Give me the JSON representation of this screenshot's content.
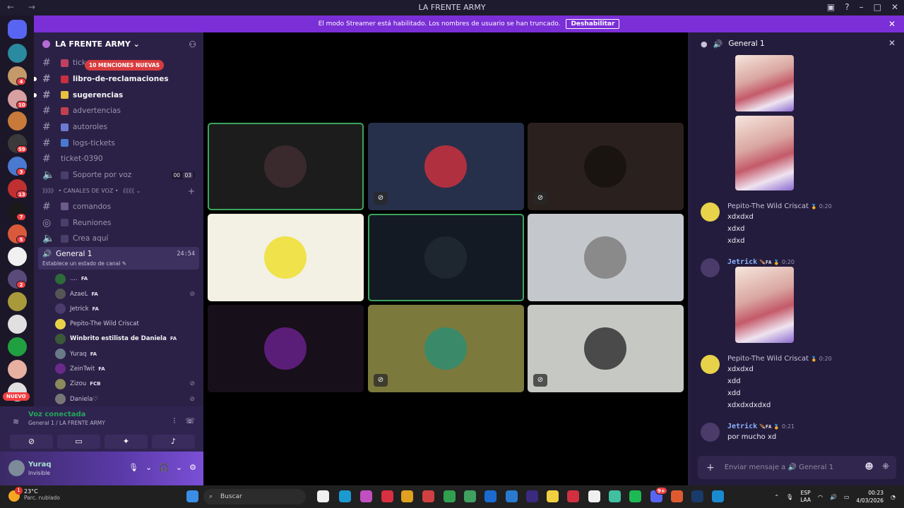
{
  "window": {
    "title": "LA FRENTE ARMY",
    "nav": "←  →"
  },
  "banner": {
    "text": "El modo Streamer está habilitado. Los nombres de usuario se han truncado.",
    "button": "Deshabilitar"
  },
  "servers": {
    "badges": [
      "4",
      "10",
      "59",
      "3",
      "13",
      "7",
      "5",
      "2"
    ],
    "new_label": "NUEVO"
  },
  "guild": {
    "name": "LA FRENTE ARMY ⌄"
  },
  "mentions_pill": "10 MENCIONES NUEVAS",
  "channels_text": [
    {
      "name": "tick",
      "bold": false
    },
    {
      "name": "libro-de-reclamaciones",
      "bold": true
    },
    {
      "name": "sugerencias",
      "bold": true
    },
    {
      "name": "advertencias",
      "bold": false
    },
    {
      "name": "autoroles",
      "bold": false
    },
    {
      "name": "logs-tickets",
      "bold": false
    }
  ],
  "ticket_channel": "ticket-0390",
  "support_voice": {
    "name": "Soporte por voz",
    "count_a": "00",
    "count_b": "03"
  },
  "voice_category": "》》》》 • CANALES DE VOZ • 《《《《 ⌄",
  "voice_channels": [
    "comandos",
    "Reuniones",
    "Crea aquí"
  ],
  "active_voice": {
    "name": "General 1",
    "status": "Establece un estado de canal ✎",
    "timer": "24:54"
  },
  "members": [
    {
      "name": "....",
      "tag": "FA",
      "muted": false,
      "color": "#2e6b3a"
    },
    {
      "name": "AzaeL",
      "tag": "FA",
      "muted": true,
      "color": "#555"
    },
    {
      "name": "Jetrick",
      "tag": "FA",
      "muted": false,
      "color": "#4a3b6b"
    },
    {
      "name": "Pepito-The Wild Criscat",
      "tag": "",
      "muted": false,
      "color": "#e8d24a"
    },
    {
      "name": "Winbrito estilista de Daniela",
      "tag": "FA",
      "muted": false,
      "color": "#3a5a3a"
    },
    {
      "name": "Yuraq",
      "tag": "FA",
      "muted": false,
      "color": "#6a7a88"
    },
    {
      "name": "ZeinTwit",
      "tag": "FA",
      "muted": false,
      "color": "#6a2a8a"
    },
    {
      "name": "Zizou",
      "tag": "FCB",
      "muted": true,
      "color": "#8a8a5a"
    },
    {
      "name": "Daniela♡",
      "tag": "",
      "muted": true,
      "color": "#777"
    }
  ],
  "voice_panel": {
    "status": "Voz conectada",
    "location": "General 1 / LA FRENTE ARMY"
  },
  "user_panel": {
    "name": "Yuraq",
    "status": "Invisible"
  },
  "tiles": [
    {
      "bg": "#1c1c1c",
      "av": "#3a2a2e",
      "speaking": true,
      "muted": false
    },
    {
      "bg": "#27304a",
      "av": "#b03040",
      "speaking": false,
      "muted": true
    },
    {
      "bg": "#2a211e",
      "av": "#1a1410",
      "speaking": false,
      "muted": true
    },
    {
      "bg": "#f3f1e3",
      "av": "#efe24a",
      "speaking": false,
      "muted": false
    },
    {
      "bg": "#141a24",
      "av": "#1e2630",
      "speaking": true,
      "muted": false
    },
    {
      "bg": "#c4c7cb",
      "av": "#8a8a8a",
      "speaking": false,
      "muted": false
    },
    {
      "bg": "#170f19",
      "av": "#5a1e78",
      "speaking": false,
      "muted": false
    },
    {
      "bg": "#7b7a3c",
      "av": "#3a8a6a",
      "speaking": false,
      "muted": true
    },
    {
      "bg": "#c6c8c4",
      "av": "#4a4a4a",
      "speaking": false,
      "muted": true
    }
  ],
  "chat": {
    "header": "General 1",
    "messages": [
      {
        "author": "Pepito-The Wild Criscat",
        "time": "0:20",
        "lines": [
          "xdxdxd",
          "xdxd",
          "xdxd"
        ]
      },
      {
        "author": "Jetrick",
        "tag": "FA",
        "time": "0:20",
        "lines": []
      },
      {
        "author": "Pepito-The Wild Criscat",
        "time": "0:20",
        "lines": [
          "xdxdxd",
          "xdd",
          "xdd",
          "xdxdxdxdxd"
        ]
      },
      {
        "author": "Jetrick",
        "tag": "FA",
        "time": "0:21",
        "lines": [
          "por mucho xd"
        ]
      }
    ],
    "input_placeholder": "Enviar mensaje a 🔊 General 1"
  },
  "taskbar": {
    "weather_temp": "23°C",
    "weather_desc": "Parc. nublado",
    "weather_badge": "1",
    "search": "Buscar",
    "lang_top": "ESP",
    "lang_bottom": "LAA",
    "time": "00:23",
    "date": "4/03/2026",
    "tray_badge": "9+"
  }
}
